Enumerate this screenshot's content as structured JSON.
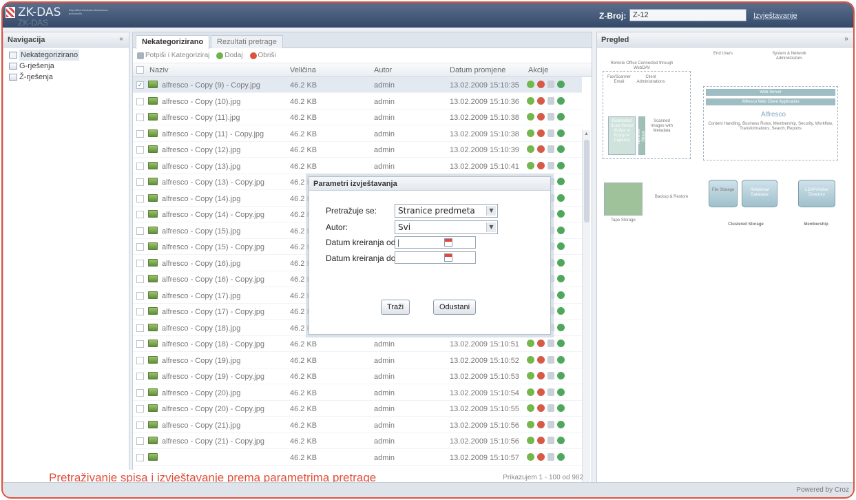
{
  "header": {
    "app_name": "ZK-DAS",
    "app_subtitle": "Republika Hrvatska Ministarstvo pravosuđa",
    "app_name_ghost": "ZK-DAS",
    "zbroj_label": "Z-Broj:",
    "zbroj_value": "Z-12",
    "report_link": "Izvještavanje"
  },
  "navigation": {
    "title": "Navigacija",
    "collapse": "«",
    "items": [
      {
        "label": "Nekategorizirano"
      },
      {
        "label": "G-rješenja"
      },
      {
        "label": "Ž-rješenja"
      }
    ]
  },
  "center": {
    "tabs": [
      "Nekategorizirano",
      "Rezultati pretrage"
    ],
    "toolbar": {
      "sign": "Potpiši i Kategoriziraj",
      "add": "Dodaj",
      "delete": "Obriši"
    },
    "columns": {
      "name": "Naziv",
      "size": "Veličina",
      "author": "Autor",
      "date": "Datum promjene",
      "actions": "Akcije"
    },
    "rows": [
      {
        "name": "alfresco - Copy (9) - Copy.jpg",
        "size": "46.2 KB",
        "author": "admin",
        "date": "13.02.2009 15:10:35"
      },
      {
        "name": "alfresco - Copy (10).jpg",
        "size": "46.2 KB",
        "author": "admin",
        "date": "13.02.2009 15:10:36"
      },
      {
        "name": "alfresco - Copy (11).jpg",
        "size": "46.2 KB",
        "author": "admin",
        "date": "13.02.2009 15:10:38"
      },
      {
        "name": "alfresco - Copy (11) - Copy.jpg",
        "size": "46.2 KB",
        "author": "admin",
        "date": "13.02.2009 15:10:38"
      },
      {
        "name": "alfresco - Copy (12).jpg",
        "size": "46.2 KB",
        "author": "admin",
        "date": "13.02.2009 15:10:39"
      },
      {
        "name": "alfresco - Copy (13).jpg",
        "size": "46.2 KB",
        "author": "admin",
        "date": "13.02.2009 15:10:41"
      },
      {
        "name": "alfresco - Copy (13) - Copy.jpg",
        "size": "46.2 KB",
        "author": "",
        "date": ""
      },
      {
        "name": "alfresco - Copy (14).jpg",
        "size": "46.2 KB",
        "author": "",
        "date": ""
      },
      {
        "name": "alfresco - Copy (14) - Copy.jpg",
        "size": "46.2 KB",
        "author": "",
        "date": ""
      },
      {
        "name": "alfresco - Copy (15).jpg",
        "size": "46.2 KB",
        "author": "",
        "date": ""
      },
      {
        "name": "alfresco - Copy (15) - Copy.jpg",
        "size": "46.2 KB",
        "author": "",
        "date": ""
      },
      {
        "name": "alfresco - Copy (16).jpg",
        "size": "46.2 KB",
        "author": "",
        "date": ""
      },
      {
        "name": "alfresco - Copy (16) - Copy.jpg",
        "size": "46.2 KB",
        "author": "",
        "date": ""
      },
      {
        "name": "alfresco - Copy (17).jpg",
        "size": "46.2 KB",
        "author": "",
        "date": ""
      },
      {
        "name": "alfresco - Copy (17) - Copy.jpg",
        "size": "46.2 KB",
        "author": "",
        "date": ""
      },
      {
        "name": "alfresco - Copy (18).jpg",
        "size": "46.2 KB",
        "author": "admin",
        "date": "13.02.2009 15:10:51"
      },
      {
        "name": "alfresco - Copy (18) - Copy.jpg",
        "size": "46.2 KB",
        "author": "admin",
        "date": "13.02.2009 15:10:51"
      },
      {
        "name": "alfresco - Copy (19).jpg",
        "size": "46.2 KB",
        "author": "admin",
        "date": "13.02.2009 15:10:52"
      },
      {
        "name": "alfresco - Copy (19) - Copy.jpg",
        "size": "46.2 KB",
        "author": "admin",
        "date": "13.02.2009 15:10:53"
      },
      {
        "name": "alfresco - Copy (20).jpg",
        "size": "46.2 KB",
        "author": "admin",
        "date": "13.02.2009 15:10:54"
      },
      {
        "name": "alfresco - Copy (20) - Copy.jpg",
        "size": "46.2 KB",
        "author": "admin",
        "date": "13.02.2009 15:10:55"
      },
      {
        "name": "alfresco - Copy (21).jpg",
        "size": "46.2 KB",
        "author": "admin",
        "date": "13.02.2009 15:10:56"
      },
      {
        "name": "alfresco - Copy (21) - Copy.jpg",
        "size": "46.2 KB",
        "author": "admin",
        "date": "13.02.2009 15:10:56"
      },
      {
        "name": "",
        "size": "46.2 KB",
        "author": "admin",
        "date": "13.02.2009 15:10:57"
      }
    ],
    "pager": "Prikazujem 1 - 100 od 982"
  },
  "modal": {
    "title": "Parametri izvještavanja",
    "search_label": "Pretražuje se:",
    "search_value": "Stranice predmeta",
    "author_label": "Autor:",
    "author_value": "Svi",
    "date_from_label": "Datum kreiranja od:",
    "date_to_label": "Datum kreiranja do:",
    "search_button": "Traži",
    "cancel_button": "Odustani"
  },
  "preview": {
    "title": "Pregled",
    "collapse": "»",
    "diagram": {
      "remote_office": "Remote Office Connected through WebDAV",
      "fax": "Fax/Scanner Email",
      "client_admin": "Client Administrations",
      "distributed_scan": "Distributed Scan Server (Kofax or ICopy or Capture)",
      "network_share": "Network Share",
      "scanned_images": "Scanned Images with Metadata",
      "end_users": "End Users",
      "sys_admin": "System & Network Administrators",
      "web_server": "Web Server",
      "web_client": "Alfresco Web Client Application",
      "alfresco": "Alfresco",
      "features": "Content Handling, Business Rules, Membership, Security, Workflow, Transformations, Search, Reports",
      "file_storage": "File Storage",
      "relational_db": "Relational Database",
      "ldap": "LDAP/Active Directory",
      "backup": "Backup & Restore",
      "tape": "Tape Storage",
      "clustered": "Clustered Storage",
      "membership": "Membership"
    }
  },
  "caption": "Pretraživanje spisa i izvještavanje prema parametrima pretrage",
  "footer": {
    "powered": "Powered by Croz"
  }
}
